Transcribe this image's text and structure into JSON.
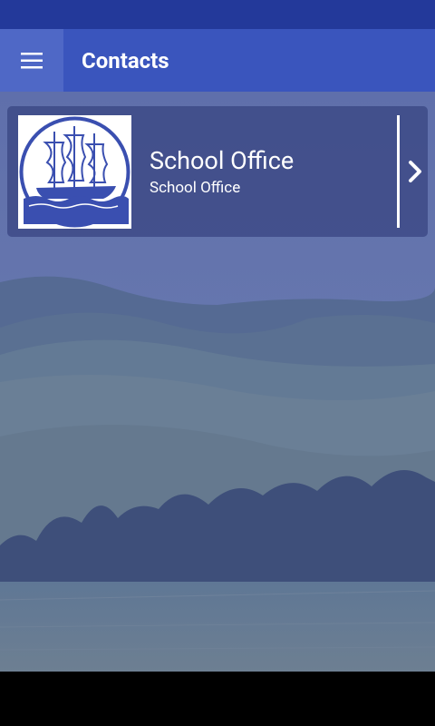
{
  "app_bar": {
    "title": "Contacts",
    "menu_icon": "hamburger-menu-icon"
  },
  "contacts": [
    {
      "name": "School Office",
      "subtitle": "School Office",
      "logo_icon": "sailing-ship-logo",
      "action_icon": "chevron-right-icon"
    }
  ],
  "colors": {
    "status_bar": "#23399a",
    "app_bar": "#3a55bd",
    "menu_button": "#4f68c6",
    "card": "#3e4a87",
    "logo_blue": "#3a4fb0"
  }
}
